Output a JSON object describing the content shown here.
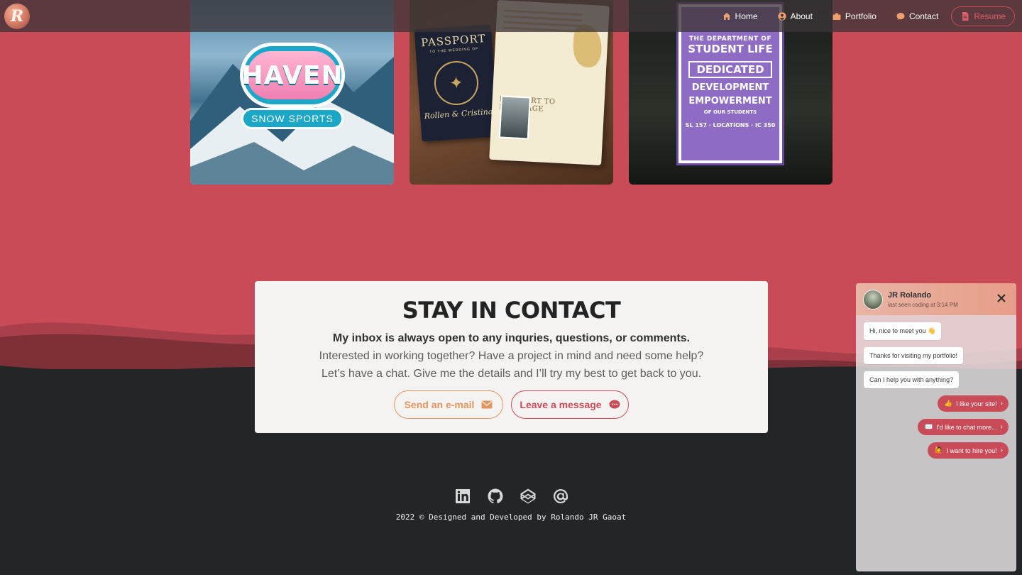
{
  "nav": {
    "logo_letter": "R",
    "links": [
      {
        "label": "Home",
        "icon": "home-icon"
      },
      {
        "label": "About",
        "icon": "user-circle-icon"
      },
      {
        "label": "Portfolio",
        "icon": "briefcase-icon"
      },
      {
        "label": "Contact",
        "icon": "chat-icon"
      }
    ],
    "resume_label": "Resume"
  },
  "portfolio": {
    "haven": {
      "title": "HAVEN",
      "subtitle": "SNOW SPORTS"
    },
    "passport": {
      "title": "PASSPORT",
      "subtitle": "TO THE WEDDING OF",
      "names": "Rollen & Cristina",
      "page_title": "PASSPORT TO MARRIAGE"
    },
    "student_life": {
      "line1": "THE DEPARTMENT OF",
      "line2": "STUDENT LIFE",
      "line3": "DEDICATED",
      "line4": "DEVELOPMENT",
      "line5": "EMPOWERMENT",
      "line6": "OF OUR STUDENTS",
      "footer": "SL 157 · LOCATIONS · IC 350"
    }
  },
  "contact": {
    "title": "STAY IN CONTACT",
    "lead": "My inbox is always open to any inquries, questions, or comments.",
    "line1": "Interested in working together? Have a project in mind and need some help?",
    "line2": "Let’s have a chat. Give me the details and I’ll try my best to get back to you.",
    "email_label": "Send an e-mail",
    "message_label": "Leave a message"
  },
  "footer": {
    "socials": [
      "linkedin-icon",
      "github-icon",
      "codepen-icon",
      "at-sign-icon"
    ],
    "copyright": "2022 © Designed and Developed by Rolando JR Gaoat"
  },
  "chat": {
    "name": "JR Rolando",
    "status": "last seen coding at 3:14 PM",
    "incoming": [
      {
        "text": "Hi, nice to meet you",
        "emoji": "👋"
      },
      {
        "text": "Thanks for visiting my portfolio!",
        "emoji": ""
      },
      {
        "text": "Can I help you with anything?",
        "emoji": ""
      }
    ],
    "replies": [
      {
        "emoji": "👍",
        "text": "I like your site!"
      },
      {
        "emoji": "✉️",
        "text": "I'd like to chat more..."
      },
      {
        "emoji": "🙋",
        "text": "I want to hire you!"
      }
    ]
  },
  "colors": {
    "brand_red": "#c94b58",
    "accent_orange": "#e2965f",
    "dark": "#232629"
  }
}
